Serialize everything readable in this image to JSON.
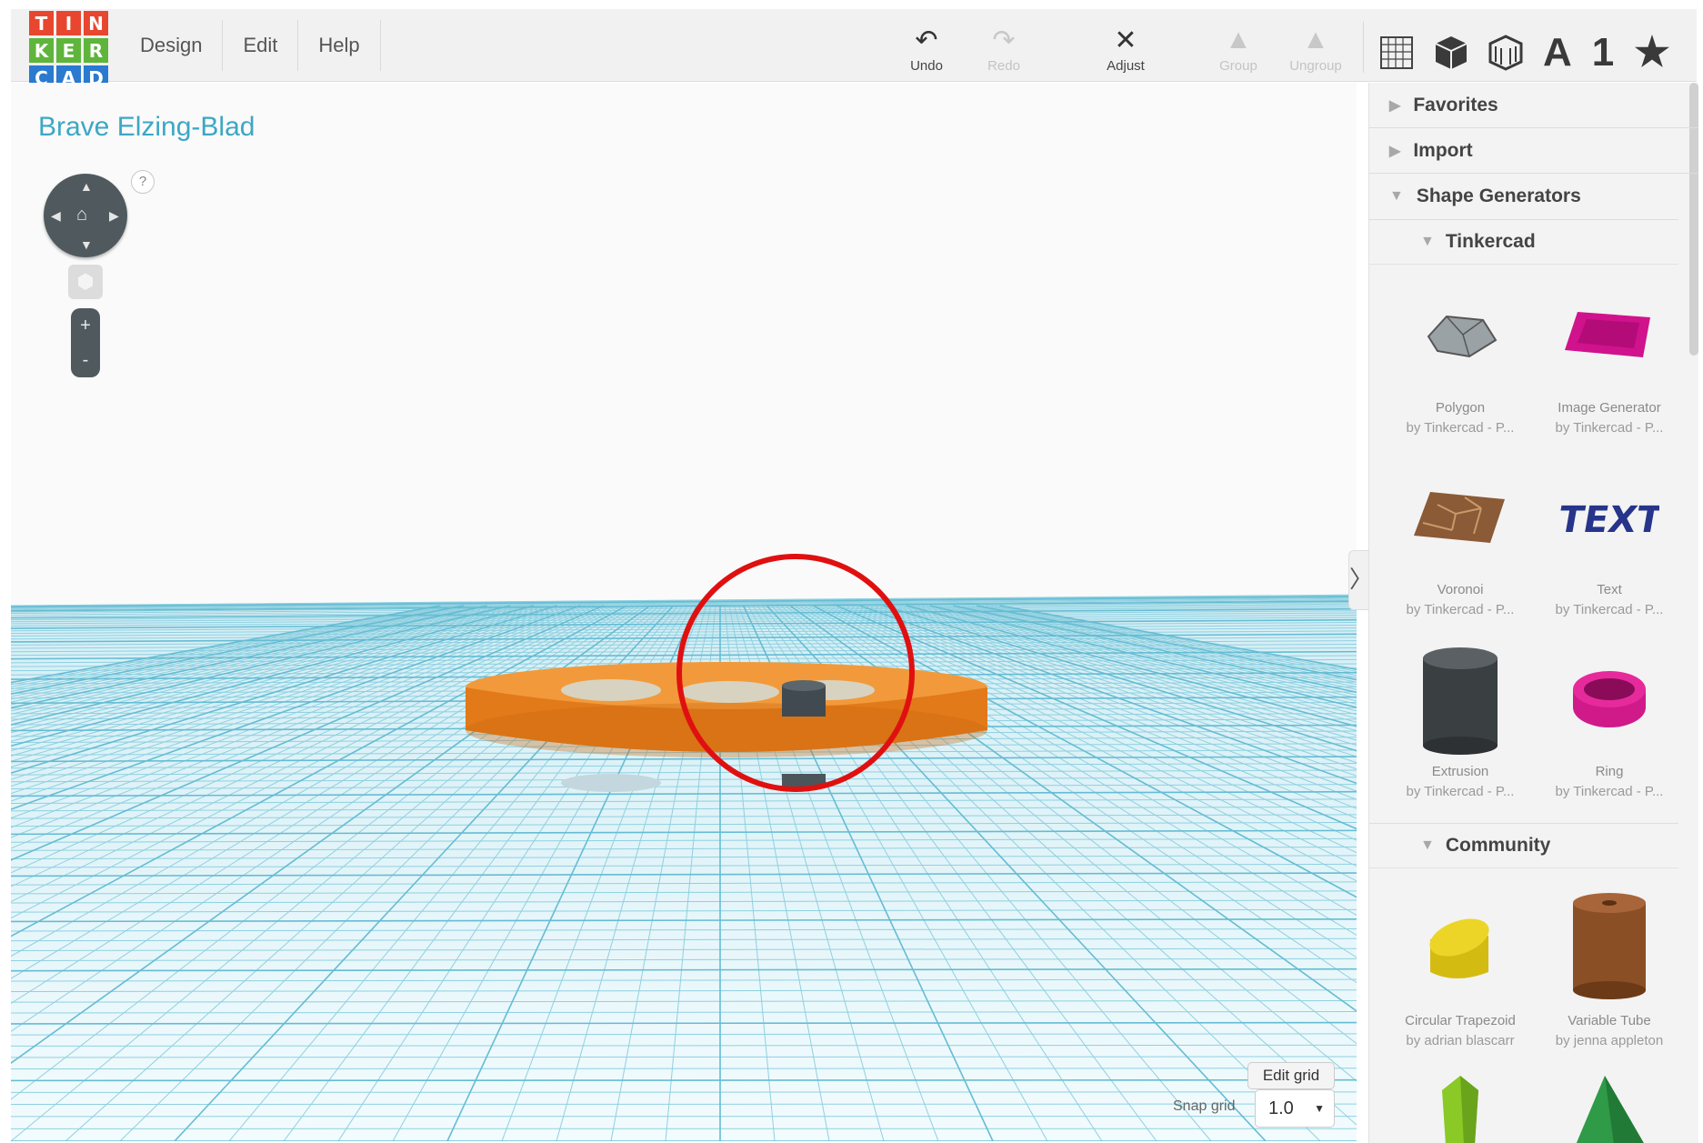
{
  "app": {
    "logo_letters": [
      "T",
      "I",
      "N",
      "K",
      "E",
      "R",
      "C",
      "A",
      "D"
    ],
    "logo_colors": [
      "#e8462f",
      "#e8462f",
      "#e8462f",
      "#5fb53b",
      "#5fb53b",
      "#5fb53b",
      "#2a7ad0",
      "#2a7ad0",
      "#2a7ad0"
    ]
  },
  "menu": {
    "design": "Design",
    "edit": "Edit",
    "help": "Help"
  },
  "toolbar": {
    "undo": "Undo",
    "redo": "Redo",
    "adjust": "Adjust",
    "group": "Group",
    "ungroup": "Ungroup"
  },
  "view_icons": {
    "text_a": "A",
    "text_1": "1",
    "star": "★"
  },
  "workplane": {
    "design_title": "Brave Elzing-Blad",
    "help": "?",
    "zoom_in": "+",
    "zoom_out": "-",
    "edit_grid": "Edit grid",
    "snap_label": "Snap grid",
    "snap_value": "1.0",
    "collapse": "〉"
  },
  "sidebar": {
    "favorites": "Favorites",
    "import": "Import",
    "shape_generators": "Shape Generators",
    "tinkercad": "Tinkercad",
    "community": "Community",
    "tinkercad_shapes": [
      {
        "name": "Polygon",
        "by": "by Tinkercad - P..."
      },
      {
        "name": "Image Generator",
        "by": "by Tinkercad - P..."
      },
      {
        "name": "Voronoi",
        "by": "by Tinkercad - P..."
      },
      {
        "name": "Text",
        "by": "by Tinkercad - P..."
      },
      {
        "name": "Extrusion",
        "by": "by Tinkercad - P..."
      },
      {
        "name": "Ring",
        "by": "by Tinkercad - P..."
      }
    ],
    "community_shapes": [
      {
        "name": "Circular Trapezoid",
        "by": "by adrian blascarr"
      },
      {
        "name": "Variable Tube",
        "by": "by jenna appleton"
      }
    ]
  },
  "colors": {
    "accent_title": "#3ca7c4",
    "disc_orange": "#e27a1a",
    "highlight_circle": "#e01010",
    "grid_line": "#8fd0e0"
  }
}
